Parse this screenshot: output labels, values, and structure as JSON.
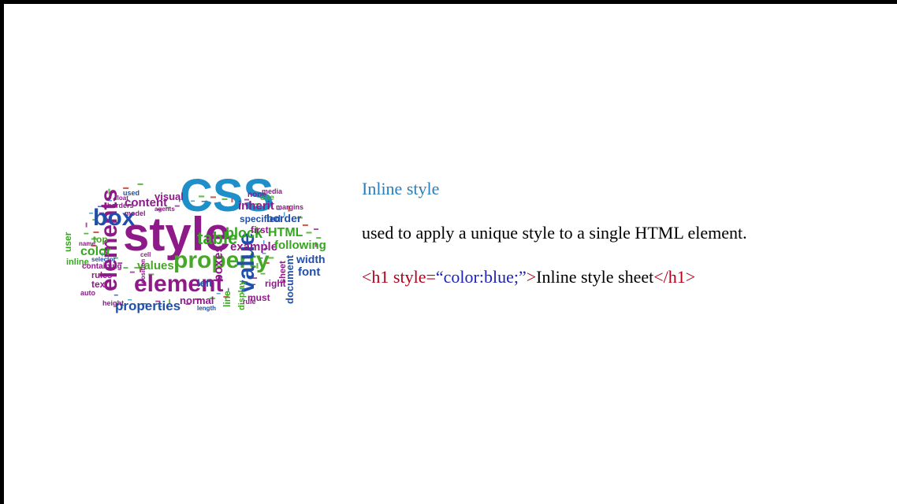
{
  "slide": {
    "heading": "Inline style",
    "description": "used to apply a unique style to a single HTML element.",
    "code": {
      "open_tag": "<h1 style=",
      "attr_value": "“color:blue;”",
      "open_tag_close": ">",
      "content": "Inline style sheet",
      "close_tag": "</h1>",
      "close_tag_end": ">"
    },
    "colors": {
      "heading": "#2a7fb8",
      "tag": "#b3001b",
      "attr_value": "#1c23b8",
      "text": "#000000"
    }
  },
  "word_cloud": {
    "icon": "css-word-cloud-image",
    "words": [
      "CSS",
      "style",
      "elements",
      "element",
      "property",
      "value",
      "box",
      "table",
      "properties",
      "block",
      "content",
      "visual",
      "color",
      "values",
      "example",
      "HTML",
      "inherit",
      "specified",
      "border",
      "first",
      "following",
      "width",
      "font",
      "document",
      "boxes",
      "line",
      "left",
      "right",
      "normal",
      "display",
      "must",
      "sheet",
      "used",
      "text",
      "top",
      "rules",
      "inline",
      "containing",
      "model",
      "borders",
      "user",
      "float",
      "media",
      "none",
      "one",
      "margins",
      "rule",
      "auto",
      "height",
      "agents",
      "selector",
      "cell",
      "name",
      "length",
      "position"
    ]
  }
}
